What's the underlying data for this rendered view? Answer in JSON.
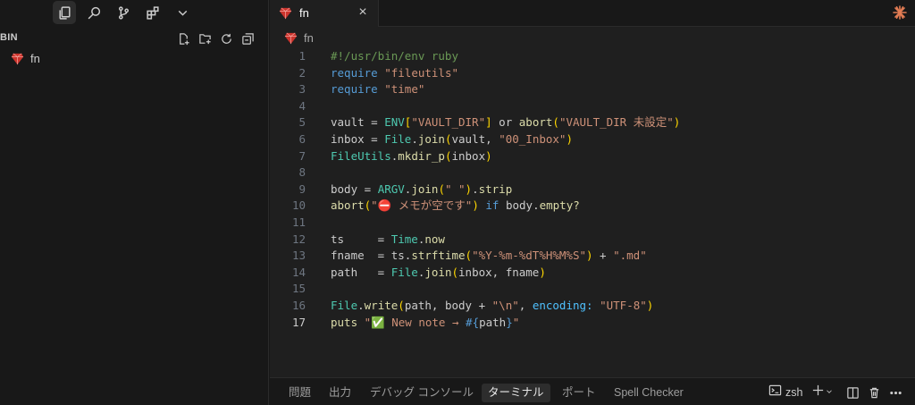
{
  "sidebar": {
    "section_title": "BIN",
    "files": [
      {
        "name": "fn"
      }
    ]
  },
  "editor": {
    "tab": {
      "label": "fn",
      "close": "×"
    },
    "breadcrumb": "fn",
    "active_line": 17,
    "lines": [
      {
        "n": "1",
        "tokens": [
          [
            "t-comment",
            "#!/usr/bin/env ruby"
          ]
        ]
      },
      {
        "n": "2",
        "tokens": [
          [
            "t-kw",
            "require"
          ],
          [
            "t-var",
            " "
          ],
          [
            "t-str",
            "\"fileutils\""
          ]
        ]
      },
      {
        "n": "3",
        "tokens": [
          [
            "t-kw",
            "require"
          ],
          [
            "t-var",
            " "
          ],
          [
            "t-str",
            "\"time\""
          ]
        ]
      },
      {
        "n": "4",
        "tokens": []
      },
      {
        "n": "5",
        "tokens": [
          [
            "t-var",
            "vault = "
          ],
          [
            "t-const",
            "ENV"
          ],
          [
            "t-br1",
            "["
          ],
          [
            "t-str",
            "\"VAULT_DIR\""
          ],
          [
            "t-br1",
            "]"
          ],
          [
            "t-var",
            " or "
          ],
          [
            "t-method",
            "abort"
          ],
          [
            "t-br1",
            "("
          ],
          [
            "t-str",
            "\"VAULT_DIR 未設定\""
          ],
          [
            "t-br1",
            ")"
          ]
        ]
      },
      {
        "n": "6",
        "tokens": [
          [
            "t-var",
            "inbox = "
          ],
          [
            "t-const",
            "File"
          ],
          [
            "t-var",
            "."
          ],
          [
            "t-method",
            "join"
          ],
          [
            "t-br1",
            "("
          ],
          [
            "t-var",
            "vault, "
          ],
          [
            "t-str",
            "\"00_Inbox\""
          ],
          [
            "t-br1",
            ")"
          ]
        ]
      },
      {
        "n": "7",
        "tokens": [
          [
            "t-const",
            "FileUtils"
          ],
          [
            "t-var",
            "."
          ],
          [
            "t-method",
            "mkdir_p"
          ],
          [
            "t-br1",
            "("
          ],
          [
            "t-var",
            "inbox"
          ],
          [
            "t-br1",
            ")"
          ]
        ]
      },
      {
        "n": "8",
        "tokens": []
      },
      {
        "n": "9",
        "tokens": [
          [
            "t-var",
            "body = "
          ],
          [
            "t-const",
            "ARGV"
          ],
          [
            "t-var",
            "."
          ],
          [
            "t-method",
            "join"
          ],
          [
            "t-br1",
            "("
          ],
          [
            "t-str",
            "\" \""
          ],
          [
            "t-br1",
            ")"
          ],
          [
            "t-var",
            "."
          ],
          [
            "t-method",
            "strip"
          ]
        ]
      },
      {
        "n": "10",
        "tokens": [
          [
            "t-method",
            "abort"
          ],
          [
            "t-br1",
            "("
          ],
          [
            "t-str",
            "\"⛔ メモが空です\""
          ],
          [
            "t-br1",
            ")"
          ],
          [
            "t-var",
            " "
          ],
          [
            "t-kw",
            "if"
          ],
          [
            "t-var",
            " body."
          ],
          [
            "t-method",
            "empty?"
          ]
        ]
      },
      {
        "n": "11",
        "tokens": []
      },
      {
        "n": "12",
        "tokens": [
          [
            "t-var",
            "ts     = "
          ],
          [
            "t-const",
            "Time"
          ],
          [
            "t-var",
            "."
          ],
          [
            "t-method",
            "now"
          ]
        ]
      },
      {
        "n": "13",
        "tokens": [
          [
            "t-var",
            "fname  = ts."
          ],
          [
            "t-method",
            "strftime"
          ],
          [
            "t-br1",
            "("
          ],
          [
            "t-str",
            "\"%Y-%m-%dT%H%M%S\""
          ],
          [
            "t-br1",
            ")"
          ],
          [
            "t-var",
            " + "
          ],
          [
            "t-str",
            "\".md\""
          ]
        ]
      },
      {
        "n": "14",
        "tokens": [
          [
            "t-var",
            "path   = "
          ],
          [
            "t-const",
            "File"
          ],
          [
            "t-var",
            "."
          ],
          [
            "t-method",
            "join"
          ],
          [
            "t-br1",
            "("
          ],
          [
            "t-var",
            "inbox, fname"
          ],
          [
            "t-br1",
            ")"
          ]
        ]
      },
      {
        "n": "15",
        "tokens": []
      },
      {
        "n": "16",
        "tokens": [
          [
            "t-const",
            "File"
          ],
          [
            "t-var",
            "."
          ],
          [
            "t-method",
            "write"
          ],
          [
            "t-br1",
            "("
          ],
          [
            "t-var",
            "path, body + "
          ],
          [
            "t-str",
            "\"\\n\""
          ],
          [
            "t-var",
            ", "
          ],
          [
            "t-sym",
            "encoding:"
          ],
          [
            "t-var",
            " "
          ],
          [
            "t-str",
            "\"UTF-8\""
          ],
          [
            "t-br1",
            ")"
          ]
        ]
      },
      {
        "n": "17",
        "tokens": [
          [
            "t-method",
            "puts"
          ],
          [
            "t-var",
            " "
          ],
          [
            "t-str",
            "\"✅ New note → "
          ],
          [
            "t-interp",
            "#{"
          ],
          [
            "t-var",
            "path"
          ],
          [
            "t-interp",
            "}"
          ],
          [
            "t-str",
            "\""
          ]
        ]
      }
    ]
  },
  "panel": {
    "tabs": [
      {
        "label": "問題",
        "active": false
      },
      {
        "label": "出力",
        "active": false
      },
      {
        "label": "デバッグ コンソール",
        "active": false
      },
      {
        "label": "ターミナル",
        "active": true
      },
      {
        "label": "ポート",
        "active": false
      },
      {
        "label": "Spell Checker",
        "active": false
      }
    ],
    "terminal_name": "zsh"
  },
  "colors": {
    "accent": "#0078d4",
    "ruby": "#cc342d",
    "background": "#1f1f1f"
  },
  "icons": [
    "explorer-icon",
    "search-icon",
    "source-control-icon",
    "extensions-icon",
    "chevron-down-icon",
    "new-file-icon",
    "new-folder-icon",
    "refresh-icon",
    "collapse-all-icon",
    "ruby-file-icon",
    "close-icon",
    "copilot-icon",
    "terminal-icon",
    "plus-icon",
    "split-icon",
    "trash-icon",
    "more-icon"
  ]
}
